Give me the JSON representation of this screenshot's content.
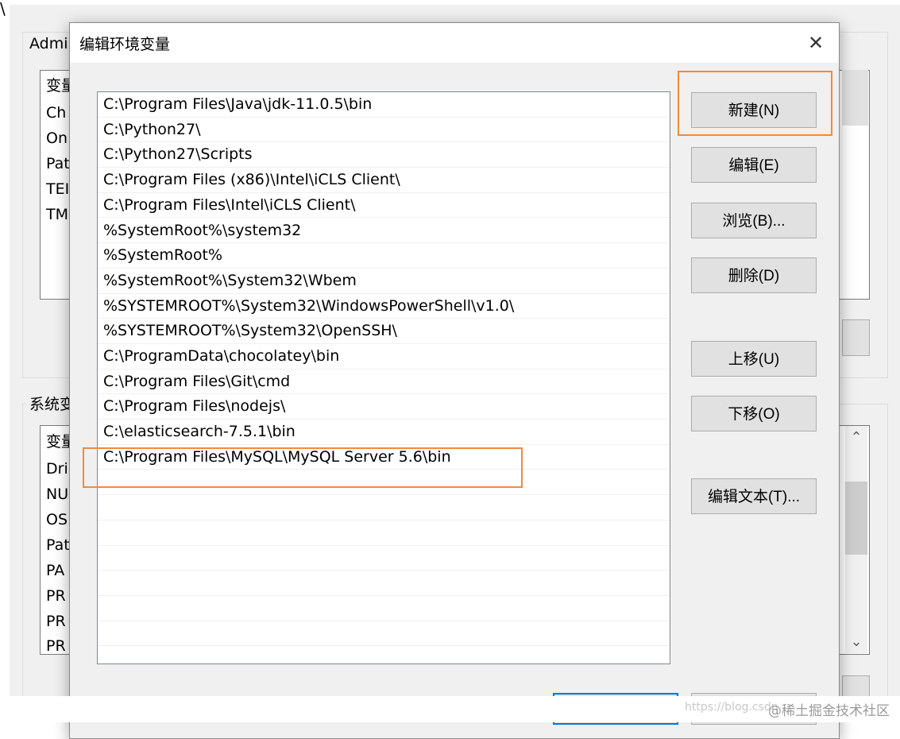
{
  "background_window": {
    "corner_glyph": "\\",
    "user_group_title": "Admi",
    "user_list": [
      "变量",
      "Ch",
      "On",
      "Pat",
      "TEI",
      "TM"
    ],
    "system_group_title": "系统变",
    "system_list": [
      "变量",
      "Dri",
      "NU",
      "OS",
      "Pat",
      "PA",
      "PR",
      "PR",
      "PR"
    ]
  },
  "dialog": {
    "title": "编辑环境变量",
    "paths": [
      "C:\\Program Files\\Java\\jdk-11.0.5\\bin",
      "C:\\Python27\\",
      "C:\\Python27\\Scripts",
      "C:\\Program Files (x86)\\Intel\\iCLS Client\\",
      "C:\\Program Files\\Intel\\iCLS Client\\",
      "%SystemRoot%\\system32",
      "%SystemRoot%",
      "%SystemRoot%\\System32\\Wbem",
      "%SYSTEMROOT%\\System32\\WindowsPowerShell\\v1.0\\",
      "%SYSTEMROOT%\\System32\\OpenSSH\\",
      "C:\\ProgramData\\chocolatey\\bin",
      "C:\\Program Files\\Git\\cmd",
      "C:\\Program Files\\nodejs\\",
      "C:\\elasticsearch-7.5.1\\bin",
      "C:\\Program Files\\MySQL\\MySQL Server 5.6\\bin"
    ],
    "buttons": {
      "new": "新建(N)",
      "edit": "编辑(E)",
      "browse": "浏览(B)...",
      "delete": "删除(D)",
      "move_up": "上移(U)",
      "move_down": "下移(O)",
      "edit_text": "编辑文本(T)..."
    }
  },
  "watermark": {
    "url": "https://blog.csdn",
    "brand": "@稀土掘金技术社区"
  },
  "colors": {
    "highlight": "#f08b3a",
    "dialog_bg": "#f0f0f0",
    "button_bg": "#e1e1e1",
    "focus": "#0078d7"
  }
}
